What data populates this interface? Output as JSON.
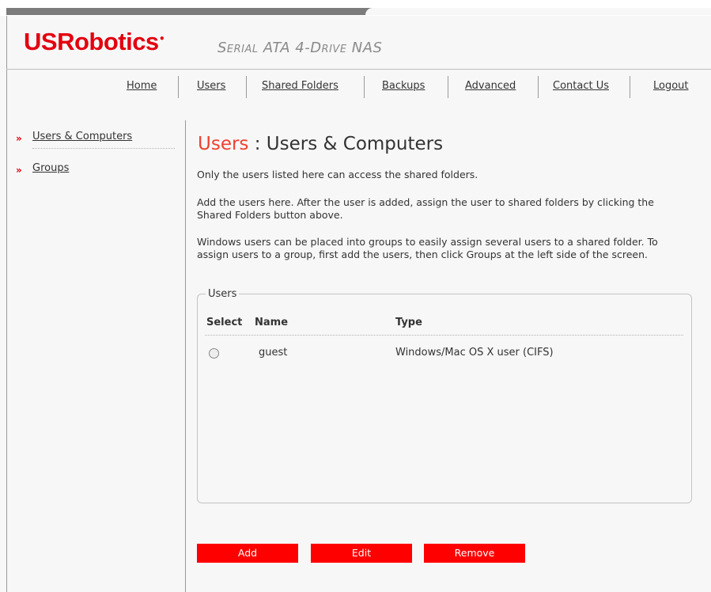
{
  "header": {
    "logo": "USRobotics",
    "product": "Serial ATA 4-Drive NAS"
  },
  "nav": [
    {
      "label": "Home"
    },
    {
      "label": "Users"
    },
    {
      "label": "Shared Folders"
    },
    {
      "label": "Backups"
    },
    {
      "label": "Advanced"
    },
    {
      "label": "Contact Us"
    },
    {
      "label": "Logout"
    }
  ],
  "sidebar": {
    "items": [
      {
        "label": "Users & Computers"
      },
      {
        "label": "Groups"
      }
    ]
  },
  "page": {
    "section": "Users",
    "separator": " : ",
    "title": "Users & Computers",
    "paragraphs": [
      "Only the users listed here can access the shared folders.",
      "Add the users here. After the user is added, assign the user to shared folders by clicking the Shared Folders button above.",
      "Windows users can be placed into groups to easily assign several users to a shared folder. To assign users to a group, first add the users, then click Groups at the left side of the screen."
    ]
  },
  "users_table": {
    "legend": "Users",
    "columns": [
      "Select",
      "Name",
      "Type"
    ],
    "rows": [
      {
        "name": "guest",
        "type": "Windows/Mac OS X user (CIFS)",
        "selected": false
      }
    ]
  },
  "actions": {
    "add": "Add",
    "edit": "Edit",
    "remove": "Remove"
  },
  "colors": {
    "brand": "#e3000f",
    "button": "#ff0000",
    "accent_title": "#f04030"
  }
}
